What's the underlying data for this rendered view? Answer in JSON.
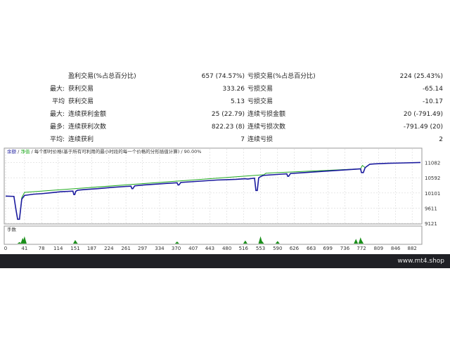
{
  "stats": {
    "rows": [
      {
        "c1": "",
        "c2": "盈利交易(%占总百分比)",
        "c3": "657 (74.57%)",
        "c4": "亏损交易(%占总百分比)",
        "c5": "224 (25.43%)"
      },
      {
        "c1": "最大:",
        "c2": "获利交易",
        "c3": "333.26",
        "c4": "亏损交易",
        "c5": "-65.14"
      },
      {
        "c1": "平均",
        "c2": "获利交易",
        "c3": "5.13",
        "c4": "亏损交易",
        "c5": "-10.17"
      },
      {
        "c1": "最大:",
        "c2": "连续获利金额",
        "c3": "25 (22.79)",
        "c4": "连续亏损金额",
        "c5": "20 (-791.49)"
      },
      {
        "c1": "最多:",
        "c2": "连续获利次数",
        "c3": "822.23 (8)",
        "c4": "连续亏损次数",
        "c5": "-791.49 (20)"
      },
      {
        "c1": "平均:",
        "c2": "连续获利",
        "c3": "7",
        "c4": "连续亏损",
        "c5": "2"
      }
    ]
  },
  "chart": {
    "legend_balance": "余额",
    "legend_sep1": "/",
    "legend_equity": "净值",
    "legend_sep2": "/",
    "legend_desc": "每个即时价格(基于所有可利用的最小时段的每一个价格的分形插值计算)",
    "legend_sep3": "/",
    "legend_quality": "90.00%",
    "volume_label": "手数",
    "colors": {
      "balance": "#1a1a9e",
      "equity": "#22aa22",
      "volume": "#1a8f1a",
      "grid": "#d8d8d8"
    }
  },
  "chart_data": {
    "type": "line",
    "x_ticks": [
      0,
      41,
      78,
      114,
      151,
      187,
      224,
      261,
      297,
      334,
      370,
      407,
      443,
      480,
      516,
      553,
      590,
      626,
      663,
      699,
      736,
      772,
      809,
      846,
      882
    ],
    "y_ticks": [
      11082,
      10592,
      10101,
      9611,
      9121
    ],
    "ylim": [
      9121,
      11300
    ],
    "xlim": [
      0,
      900
    ],
    "series": [
      {
        "name": "余额",
        "x": [
          0,
          18,
          22,
          26,
          30,
          35,
          41,
          60,
          80,
          100,
          120,
          146,
          148,
          150,
          152,
          156,
          170,
          200,
          230,
          260,
          272,
          274,
          276,
          280,
          300,
          320,
          350,
          372,
          374,
          376,
          380,
          400,
          420,
          440,
          460,
          480,
          500,
          520,
          525,
          530,
          540,
          543,
          546,
          549,
          552,
          556,
          560,
          580,
          600,
          610,
          612,
          614,
          618,
          640,
          660,
          680,
          700,
          720,
          760,
          770,
          772,
          776,
          780,
          790,
          800,
          830,
          860,
          900
        ],
        "y": [
          10000,
          9990,
          9600,
          9250,
          9250,
          9900,
          10020,
          10060,
          10080,
          10110,
          10140,
          10160,
          10050,
          10050,
          10150,
          10190,
          10210,
          10240,
          10280,
          10310,
          10320,
          10240,
          10240,
          10330,
          10360,
          10380,
          10410,
          10430,
          10360,
          10360,
          10440,
          10460,
          10480,
          10500,
          10520,
          10530,
          10540,
          10560,
          10550,
          10560,
          10580,
          10180,
          10180,
          10590,
          10620,
          10650,
          10670,
          10690,
          10710,
          10720,
          10640,
          10640,
          10730,
          10750,
          10770,
          10790,
          10810,
          10830,
          10870,
          10880,
          10760,
          10760,
          10920,
          11030,
          11040,
          11060,
          11070,
          11085
        ]
      },
      {
        "name": "净值",
        "x": [
          30,
          35,
          41,
          560,
          565,
          770,
          774,
          780
        ],
        "y": [
          9250,
          9950,
          10120,
          10690,
          10740,
          10880,
          10990,
          10920
        ]
      }
    ],
    "volume": {
      "x": [
        30,
        37,
        41,
        151,
        152,
        372,
        520,
        553,
        556,
        590,
        760,
        770,
        772
      ],
      "level": [
        0.15,
        0.55,
        0.7,
        0.35,
        0.25,
        0.2,
        0.3,
        0.7,
        0.25,
        0.25,
        0.45,
        0.6,
        0.35
      ]
    }
  },
  "footer": {
    "brand": "www.mt4.shop"
  }
}
